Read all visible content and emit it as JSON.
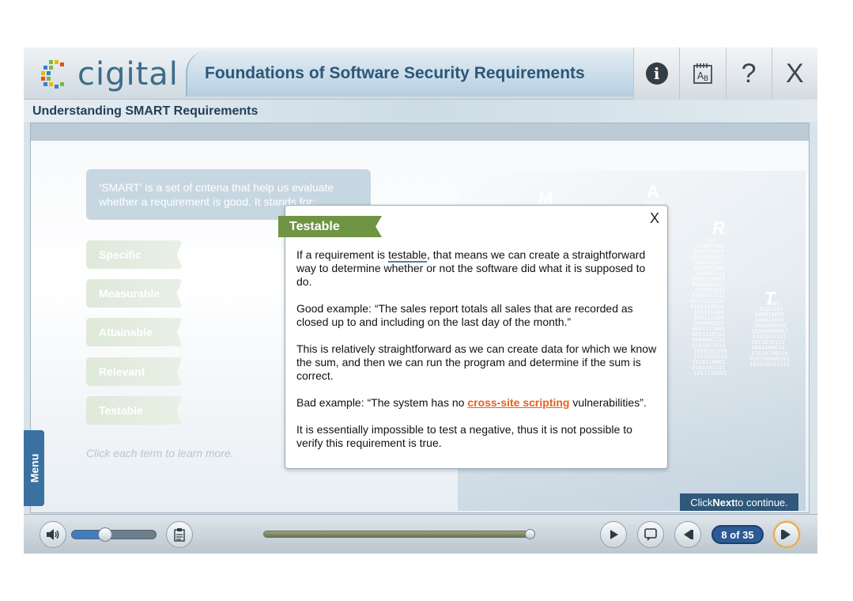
{
  "header": {
    "logo_text": "cigital",
    "course_title": "Foundations of Software Security Requirements",
    "buttons": {
      "info_icon": "info-icon",
      "glossary_icon": "glossary-icon",
      "help_label": "?",
      "close_label": "X"
    }
  },
  "section": {
    "title": "Understanding SMART Requirements"
  },
  "slide": {
    "intro": "‘SMART’ is a set of criteria that help us evaluate whether a requirement is good. It stands for:",
    "terms": [
      "Specific",
      "Measurable",
      "Attainable",
      "Relevant",
      "Testable"
    ],
    "hint": "Click each term to learn more.",
    "letters": [
      "M",
      "A",
      "R",
      "T"
    ],
    "next_hint_prefix": "Click ",
    "next_hint_bold": "Next",
    "next_hint_suffix": " to continue."
  },
  "popup": {
    "close_label": "X",
    "tab_label": "Testable",
    "p1_pre": "If a requirement is ",
    "p1_term": "testable",
    "p1_post": ", that means we can create a straightforward way to determine whether or not the software did what it is supposed to do.",
    "p2": "Good example: “The sales report totals all sales that are recorded as closed up to and including on the last day of the month.”",
    "p3": "This is relatively straightforward as we can create data for which we know the sum, and then we can run the program and determine if the sum is correct.",
    "p4_pre": "Bad example: “The system has no ",
    "p4_link": "cross-site scripting",
    "p4_post": " vulnerabilities”.",
    "p5": "It is essentially impossible to test a negative, thus it is not possible to verify this requirement is true."
  },
  "menu": {
    "label": "Menu"
  },
  "controls": {
    "page_counter": "8 of 35",
    "volume_level": 0.4,
    "progress_level": 1.0
  },
  "colors": {
    "brand_blue": "#2c5678",
    "accent_green": "#6f9444",
    "link_orange": "#e8601c",
    "counter_blue": "#2c5a94"
  }
}
